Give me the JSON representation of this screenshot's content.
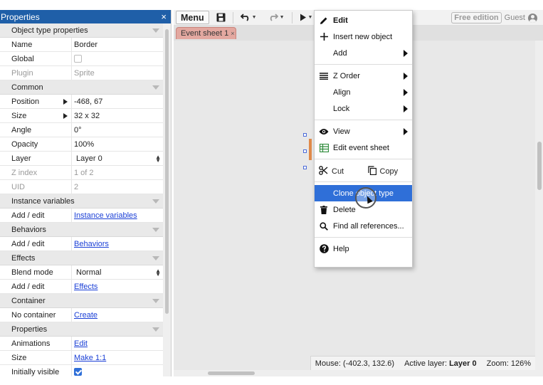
{
  "panel": {
    "title": "Properties",
    "close": "×",
    "rows": [
      {
        "type": "section",
        "label": "Object type properties"
      },
      {
        "type": "prop",
        "name": "Name",
        "value": "Border"
      },
      {
        "type": "check",
        "name": "Global",
        "checked": false
      },
      {
        "type": "prop",
        "name": "Plugin",
        "value": "Sprite",
        "dim": true
      },
      {
        "type": "section",
        "label": "Common"
      },
      {
        "type": "prop",
        "name": "Position",
        "value": "-468, 67",
        "expand": true
      },
      {
        "type": "prop",
        "name": "Size",
        "value": "32 x 32",
        "expand": true
      },
      {
        "type": "prop",
        "name": "Angle",
        "value": "0°"
      },
      {
        "type": "prop",
        "name": "Opacity",
        "value": "100%"
      },
      {
        "type": "select",
        "name": "Layer",
        "value": "Layer 0"
      },
      {
        "type": "prop",
        "name": "Z index",
        "value": "1 of 2",
        "dim": true
      },
      {
        "type": "prop",
        "name": "UID",
        "value": "2",
        "dim": true
      },
      {
        "type": "section",
        "label": "Instance variables"
      },
      {
        "type": "link",
        "name": "Add / edit",
        "value": "Instance variables"
      },
      {
        "type": "section",
        "label": "Behaviors"
      },
      {
        "type": "link",
        "name": "Add / edit",
        "value": "Behaviors"
      },
      {
        "type": "section",
        "label": "Effects"
      },
      {
        "type": "select",
        "name": "Blend mode",
        "value": "Normal"
      },
      {
        "type": "link",
        "name": "Add / edit",
        "value": "Effects"
      },
      {
        "type": "section",
        "label": "Container"
      },
      {
        "type": "link",
        "name": "No container",
        "value": "Create"
      },
      {
        "type": "section",
        "label": "Properties"
      },
      {
        "type": "link",
        "name": "Animations",
        "value": "Edit"
      },
      {
        "type": "link",
        "name": "Size",
        "value": "Make 1:1"
      },
      {
        "type": "check",
        "name": "Initially visible",
        "checked": true
      }
    ]
  },
  "toolbar": {
    "menu_label": "Menu",
    "free_badge": "Free edition",
    "user_label": "Guest"
  },
  "tabs": {
    "active": "Event sheet 1",
    "close": "×"
  },
  "statusbar": {
    "mouse_label": "Mouse:",
    "mouse_value": "(-402.3, 132.6)",
    "layer_label": "Active layer:",
    "layer_value": "Layer 0",
    "zoom_label": "Zoom:",
    "zoom_value": "126%"
  },
  "context_menu": {
    "edit": "Edit",
    "insert": "Insert new object",
    "add": "Add",
    "z_order": "Z Order",
    "align": "Align",
    "lock": "Lock",
    "view": "View",
    "edit_event_sheet": "Edit event sheet",
    "cut": "Cut",
    "copy": "Copy",
    "clone": "Clone object type",
    "delete": "Delete",
    "find": "Find all references...",
    "help": "Help"
  },
  "colors": {
    "panel_title_bg": "#1f5fa8",
    "highlight": "#2f6fd8",
    "tab_bg": "#e3a8a0",
    "link": "#1a3fd6"
  }
}
